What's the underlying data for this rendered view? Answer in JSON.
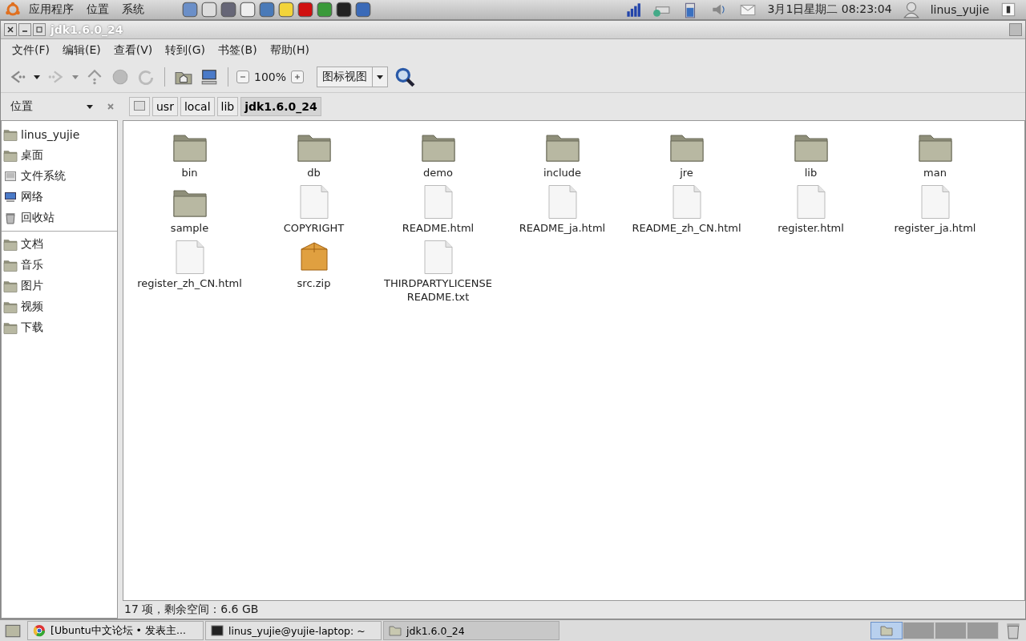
{
  "top_panel": {
    "menus": [
      "应用程序",
      "位置",
      "系统"
    ],
    "launchers": [
      {
        "kind": "cube"
      },
      {
        "kind": "speaker"
      },
      {
        "kind": "media"
      },
      {
        "kind": "document"
      },
      {
        "kind": "people"
      },
      {
        "kind": "notes"
      },
      {
        "kind": "opera"
      },
      {
        "kind": "chrome"
      },
      {
        "kind": "terminal"
      },
      {
        "kind": "mail"
      }
    ],
    "clock": "3月1日星期二 08:23:04",
    "user": "linus_yujie"
  },
  "window": {
    "title": "jdk1.6.0_24"
  },
  "menubar": [
    "文件(F)",
    "编辑(E)",
    "查看(V)",
    "转到(G)",
    "书签(B)",
    "帮助(H)"
  ],
  "toolbar": {
    "zoom": "100%",
    "view_mode": "图标视图"
  },
  "sidebar": {
    "title": "位置",
    "sections": [
      [
        {
          "label": "linus_yujie",
          "kind": "home"
        },
        {
          "label": "桌面",
          "kind": "desktop"
        },
        {
          "label": "文件系统",
          "kind": "drive"
        },
        {
          "label": "网络",
          "kind": "network"
        },
        {
          "label": "回收站",
          "kind": "trash"
        }
      ],
      [
        {
          "label": "文档",
          "kind": "folder"
        },
        {
          "label": "音乐",
          "kind": "folder"
        },
        {
          "label": "图片",
          "kind": "folder"
        },
        {
          "label": "视频",
          "kind": "folder"
        },
        {
          "label": "下载",
          "kind": "folder"
        }
      ]
    ]
  },
  "path": [
    {
      "label": "usr",
      "selected": false
    },
    {
      "label": "local",
      "selected": false
    },
    {
      "label": "lib",
      "selected": false
    },
    {
      "label": "jdk1.6.0_24",
      "selected": true
    }
  ],
  "files": [
    {
      "name": "bin",
      "kind": "folder"
    },
    {
      "name": "db",
      "kind": "folder"
    },
    {
      "name": "demo",
      "kind": "folder"
    },
    {
      "name": "include",
      "kind": "folder"
    },
    {
      "name": "jre",
      "kind": "folder"
    },
    {
      "name": "lib",
      "kind": "folder"
    },
    {
      "name": "man",
      "kind": "folder"
    },
    {
      "name": "sample",
      "kind": "folder"
    },
    {
      "name": "COPYRIGHT",
      "kind": "file"
    },
    {
      "name": "README.html",
      "kind": "file"
    },
    {
      "name": "README_ja.html",
      "kind": "file"
    },
    {
      "name": "README_zh_CN.html",
      "kind": "file"
    },
    {
      "name": "register.html",
      "kind": "file"
    },
    {
      "name": "register_ja.html",
      "kind": "file"
    },
    {
      "name": "register_zh_CN.html",
      "kind": "file"
    },
    {
      "name": "src.zip",
      "kind": "archive"
    },
    {
      "name": "THIRDPARTYLICENSEREADME.txt",
      "kind": "file"
    }
  ],
  "status": "17 项，剩余空间：6.6 GB",
  "taskbar": {
    "windows": [
      {
        "label": "[Ubuntu中文论坛 • 发表主...",
        "kind": "browser",
        "selected": false
      },
      {
        "label": "linus_yujie@yujie-laptop: ~",
        "kind": "terminal",
        "selected": false
      },
      {
        "label": "jdk1.6.0_24",
        "kind": "folder",
        "selected": true
      }
    ],
    "workspaces": [
      {
        "selected": true
      },
      {
        "selected": false
      },
      {
        "selected": false
      },
      {
        "selected": false
      }
    ]
  }
}
